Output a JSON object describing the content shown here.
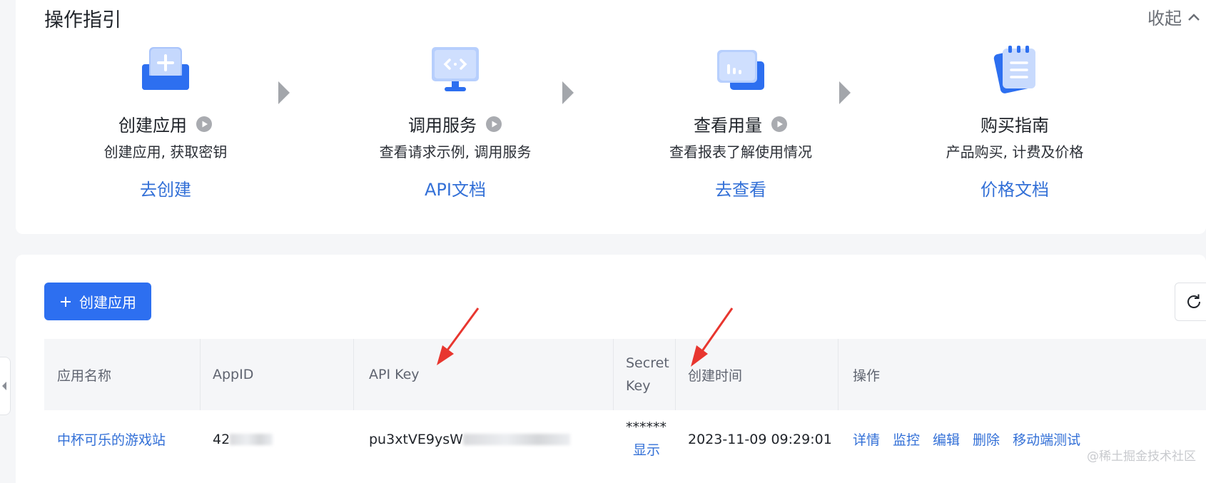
{
  "guide": {
    "title": "操作指引",
    "collapse_label": "收起",
    "steps": [
      {
        "name": "创建应用",
        "desc": "创建应用, 获取密钥",
        "link": "去创建"
      },
      {
        "name": "调用服务",
        "desc": "查看请求示例, 调用服务",
        "link": "API文档"
      },
      {
        "name": "查看用量",
        "desc": "查看报表了解使用情况",
        "link": "去查看"
      },
      {
        "name": "购买指南",
        "desc": "产品购买, 计费及价格",
        "link": "价格文档"
      }
    ]
  },
  "apps": {
    "create_label": "创建应用",
    "columns": [
      "应用名称",
      "AppID",
      "API Key",
      "Secret Key",
      "创建时间",
      "操作"
    ],
    "rows": [
      {
        "name": "中杯可乐的游戏站",
        "app_id_visible": "42",
        "api_key_visible": "pu3xtVE9ysW",
        "secret_mask": "******",
        "secret_show": "显示",
        "created": "2023-11-09 09:29:01",
        "actions": [
          "详情",
          "监控",
          "编辑",
          "删除",
          "移动端测试"
        ]
      }
    ]
  },
  "watermark": "@稀土掘金技术社区",
  "colors": {
    "accent": "#2d6ff0",
    "link": "#3370d7",
    "annotation": "#e8362f"
  }
}
